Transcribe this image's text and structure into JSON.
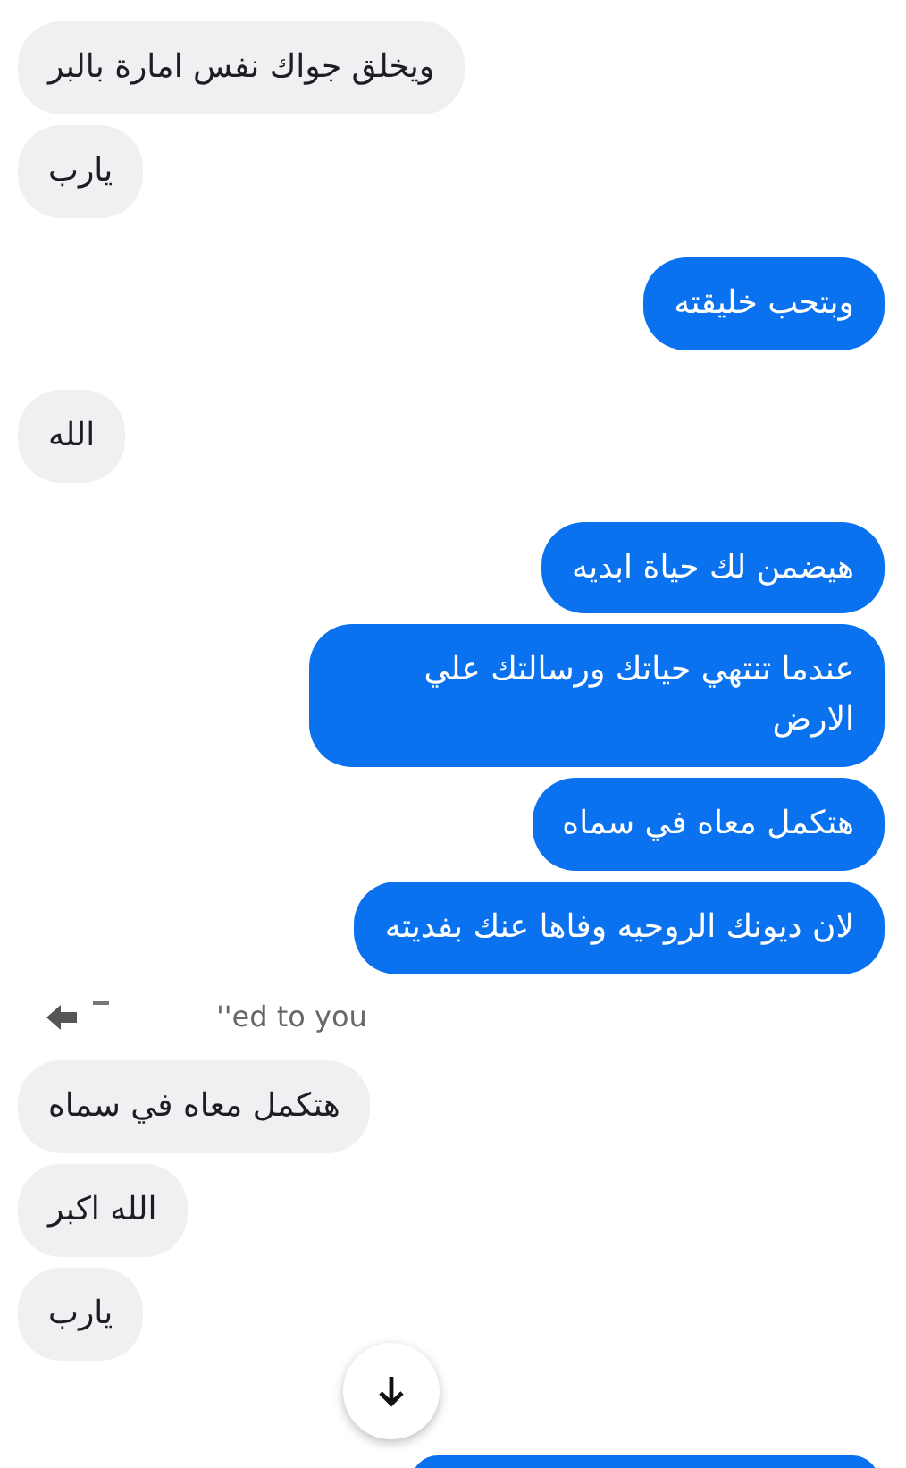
{
  "messages": [
    {
      "kind": "received",
      "text": "ويخلق جواك نفس امارة بالبر"
    },
    {
      "kind": "received",
      "text": "يارب"
    },
    {
      "kind": "sent",
      "text": "وبتحب خليقته"
    },
    {
      "kind": "received",
      "text": "الله"
    },
    {
      "kind": "sent",
      "text": "هيضمن لك حياة ابديه"
    },
    {
      "kind": "sent",
      "text": "عندما تنتهي حياتك ورسالتك علي الارض"
    },
    {
      "kind": "sent",
      "text": "هتكمل معاه في سماه"
    },
    {
      "kind": "sent",
      "text": "لان ديونك الروحيه وفاها عنك بفديته"
    },
    {
      "kind": "reply",
      "text": "''ed to you"
    },
    {
      "kind": "received",
      "text": "هتكمل معاه في سماه"
    },
    {
      "kind": "received",
      "text": "الله اكبر"
    },
    {
      "kind": "received",
      "text": "يارب"
    }
  ]
}
